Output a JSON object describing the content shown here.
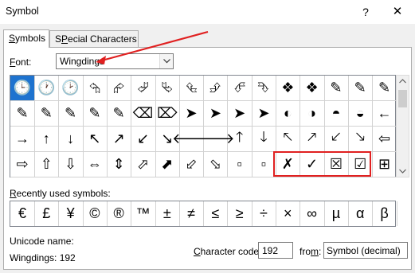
{
  "window": {
    "title": "Symbol",
    "help_label": "?",
    "close_label": "✕"
  },
  "tabs": [
    {
      "label": "Symbols",
      "accel": "S",
      "rest": "ymbols",
      "active": true
    },
    {
      "label": "Special Characters",
      "accel": "P",
      "pre": "S",
      "rest": "ecial Characters",
      "active": false
    }
  ],
  "font": {
    "label": "Font:",
    "accel": "F",
    "rest": "ont:",
    "value": "Wingdings"
  },
  "symbol_grid": {
    "rows": [
      [
        "🕒",
        "🕐",
        "🕑",
        "⮲",
        "⮳",
        "⮰",
        "⮱",
        "⮴",
        "⮵",
        "⮶",
        "⮷",
        "❖",
        "❖",
        "✎",
        "✎",
        "✎"
      ],
      [
        "✎",
        "✎",
        "✎",
        "✎",
        "✎",
        "⌫",
        "⌦",
        "➤",
        "➤",
        "➤",
        "➤",
        "◐",
        "◑",
        "◓",
        "◒",
        "←"
      ],
      [
        "→",
        "↑",
        "↓",
        "↖",
        "↗",
        "↙",
        "↘",
        "🡐",
        "🡒",
        "🡑",
        "🡓",
        "🡔",
        "🡕",
        "🡗",
        "🡖",
        "⇦"
      ],
      [
        "⇨",
        "⇧",
        "⇩",
        "⇔",
        "⇕",
        "⬀",
        "⬈",
        "⬃",
        "⬂",
        "▫",
        "▫",
        "✗",
        "✓",
        "☒",
        "☑",
        "⊞"
      ]
    ],
    "selected": "🕒"
  },
  "recent": {
    "label": "Recently used symbols:",
    "accel": "R",
    "rest": "ecently used symbols:",
    "symbols": [
      "€",
      "£",
      "¥",
      "©",
      "®",
      "™",
      "±",
      "≠",
      "≤",
      "≥",
      "÷",
      "×",
      "∞",
      "µ",
      "α",
      "β"
    ]
  },
  "unicode": {
    "label": "Unicode name:",
    "value": "Wingdings: 192"
  },
  "char_code": {
    "label": "Character code:",
    "accel": "C",
    "rest": "haracter code:",
    "value": "192"
  },
  "from": {
    "label": "from:",
    "accel": "m",
    "pre": "fro",
    "rest": ":",
    "value": "Symbol (decimal)"
  },
  "colors": {
    "selection": "#1e73cf",
    "annotation": "#e02020"
  }
}
